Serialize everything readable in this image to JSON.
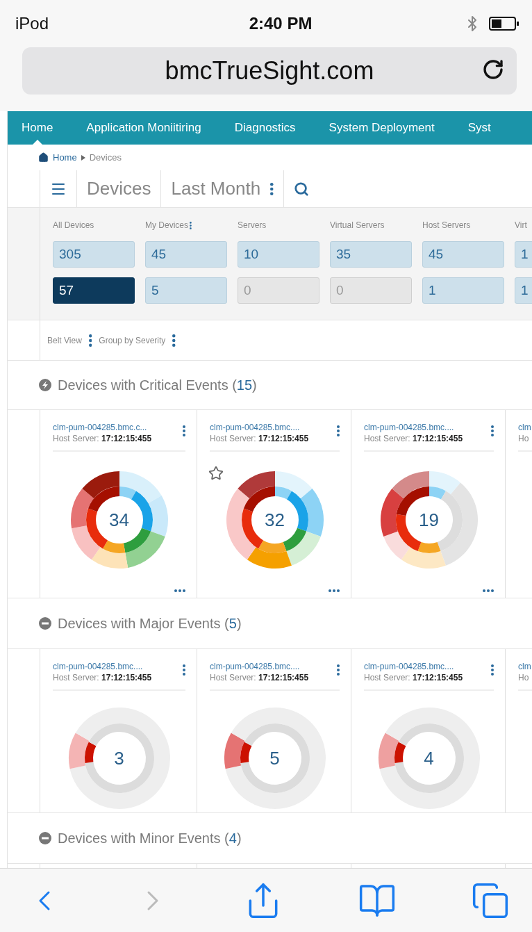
{
  "status_bar": {
    "device": "iPod",
    "time": "2:40 PM"
  },
  "address_bar": {
    "url": "bmcTrueSight.com"
  },
  "nav": [
    {
      "label": "Home",
      "selected": true
    },
    {
      "label": "Application Moniitiring",
      "selected": false
    },
    {
      "label": "Diagnostics",
      "selected": false
    },
    {
      "label": "System Deployment",
      "selected": false
    },
    {
      "label": "Syst",
      "selected": false
    }
  ],
  "breadcrumb": {
    "home": "Home",
    "current": "Devices"
  },
  "toolbar": {
    "title": "Devices",
    "period": "Last Month"
  },
  "stats": [
    {
      "label": "All Devices",
      "has_menu": false,
      "total": {
        "value": "305",
        "selected": false,
        "muted": false
      },
      "alert": {
        "value": "57",
        "selected": true,
        "muted": false
      }
    },
    {
      "label": "My Devices",
      "has_menu": true,
      "total": {
        "value": "45",
        "selected": false,
        "muted": false
      },
      "alert": {
        "value": "5",
        "selected": false,
        "muted": false
      }
    },
    {
      "label": "Servers",
      "has_menu": false,
      "total": {
        "value": "10",
        "selected": false,
        "muted": false
      },
      "alert": {
        "value": "0",
        "selected": false,
        "muted": true
      }
    },
    {
      "label": "Virtual Servers",
      "has_menu": false,
      "total": {
        "value": "35",
        "selected": false,
        "muted": false
      },
      "alert": {
        "value": "0",
        "selected": false,
        "muted": true
      }
    },
    {
      "label": "Host Servers",
      "has_menu": false,
      "total": {
        "value": "45",
        "selected": false,
        "muted": false
      },
      "alert": {
        "value": "1",
        "selected": false,
        "muted": false
      }
    },
    {
      "label": "Virt",
      "has_menu": false,
      "total": {
        "value": "1",
        "selected": false,
        "muted": false
      },
      "alert": {
        "value": "1",
        "selected": false,
        "muted": false
      }
    }
  ],
  "view_options": [
    {
      "label": "Belt View"
    },
    {
      "label": "Group by Severity"
    }
  ],
  "sections": [
    {
      "kind": "critical",
      "title": "Devices with Critical Events",
      "count": "(15)",
      "cards": [
        {
          "name": "clm-pum-004285.bmc.c...",
          "host_label": "Host Server:",
          "time": "17:12:15:455",
          "count": "34",
          "starred": false
        },
        {
          "name": "clm-pum-004285.bmc....",
          "host_label": "Host Server:",
          "time": "17:12:15:455",
          "count": "32",
          "starred": true
        },
        {
          "name": "clm-pum-004285.bmc....",
          "host_label": "Host Server:",
          "time": "17:12:15:455",
          "count": "19",
          "starred": false
        },
        {
          "name": "clm",
          "host_label": "Ho",
          "starred": false
        }
      ]
    },
    {
      "kind": "major",
      "title": "Devices with Major Events",
      "count": "(5)",
      "cards": [
        {
          "name": "clm-pum-004285.bmc....",
          "host_label": "Host Server:",
          "time": "17:12:15:455",
          "count": "3",
          "starred": false
        },
        {
          "name": "clm-pum-004285.bmc....",
          "host_label": "Host Server:",
          "time": "17:12:15:455",
          "count": "5",
          "starred": false
        },
        {
          "name": "clm-pum-004285.bmc....",
          "host_label": "Host Server:",
          "time": "17:12:15:455",
          "count": "4",
          "starred": false
        },
        {
          "name": "clm",
          "host_label": "Ho",
          "starred": false
        }
      ]
    },
    {
      "kind": "minor",
      "title": "Devices with Minor Events",
      "count": "(4)"
    }
  ],
  "browser_toolbar": [
    {
      "kind": "back",
      "disabled": false
    },
    {
      "kind": "forward",
      "disabled": true
    },
    {
      "kind": "share",
      "disabled": false
    },
    {
      "kind": "bookmarks",
      "disabled": false
    },
    {
      "kind": "tabs",
      "disabled": false
    }
  ]
}
